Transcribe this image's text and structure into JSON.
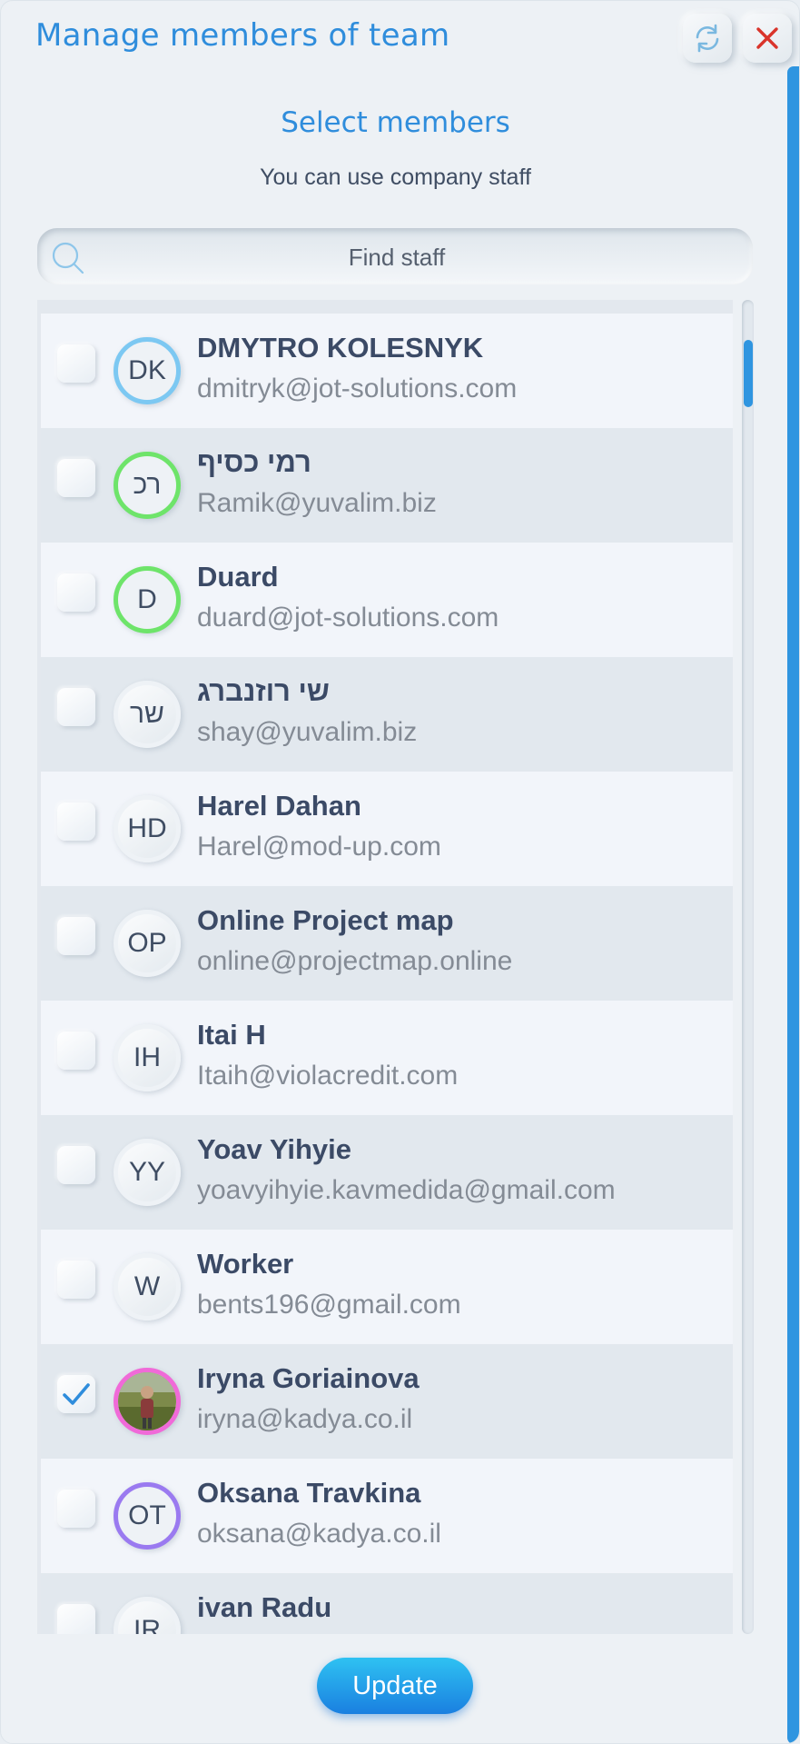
{
  "header": {
    "title": "Manage members of team",
    "refresh_icon": "refresh-icon",
    "close_icon": "close-icon"
  },
  "section": {
    "title": "Select members",
    "hint": "You can use company staff"
  },
  "search": {
    "placeholder": "Find staff",
    "icon": "search-icon"
  },
  "members": [
    {
      "initials": "DK",
      "name": "DMYTRO KOLESNYK",
      "email": "dmitryk@jot-solutions.com",
      "checked": false,
      "ring": "#7cc8f2"
    },
    {
      "initials": "רכ",
      "name": "רמי כסיף",
      "email": "Ramik@yuvalim.biz",
      "checked": false,
      "ring": "#6ee46a"
    },
    {
      "initials": "D",
      "name": "Duard",
      "email": "duard@jot-solutions.com",
      "checked": false,
      "ring": "#6ee46a"
    },
    {
      "initials": "שר",
      "name": "שי רוזנברג",
      "email": "shay@yuvalim.biz",
      "checked": false,
      "ring": ""
    },
    {
      "initials": "HD",
      "name": "Harel Dahan",
      "email": "Harel@mod-up.com",
      "checked": false,
      "ring": ""
    },
    {
      "initials": "OP",
      "name": "Online Project map",
      "email": "online@projectmap.online",
      "checked": false,
      "ring": ""
    },
    {
      "initials": "IH",
      "name": "Itai H",
      "email": "Itaih@violacredit.com",
      "checked": false,
      "ring": ""
    },
    {
      "initials": "YY",
      "name": "Yoav Yihyie",
      "email": "yoavyihyie.kavmedida@gmail.com",
      "checked": false,
      "ring": ""
    },
    {
      "initials": "W",
      "name": "Worker",
      "email": "bents196@gmail.com",
      "checked": false,
      "ring": ""
    },
    {
      "initials": "",
      "name": "Iryna Goriainova",
      "email": "iryna@kadya.co.il",
      "checked": true,
      "ring": "#f06ad8",
      "photo": true
    },
    {
      "initials": "OT",
      "name": "Oksana Travkina",
      "email": "oksana@kadya.co.il",
      "checked": false,
      "ring": "#9a7af0"
    },
    {
      "initials": "IR",
      "name": "ivan Radu",
      "email": "",
      "checked": false,
      "ring": ""
    }
  ],
  "footer": {
    "update_label": "Update"
  },
  "colors": {
    "accent": "#2f8ddc",
    "check": "#2f8ddc",
    "close": "#d9342b"
  }
}
